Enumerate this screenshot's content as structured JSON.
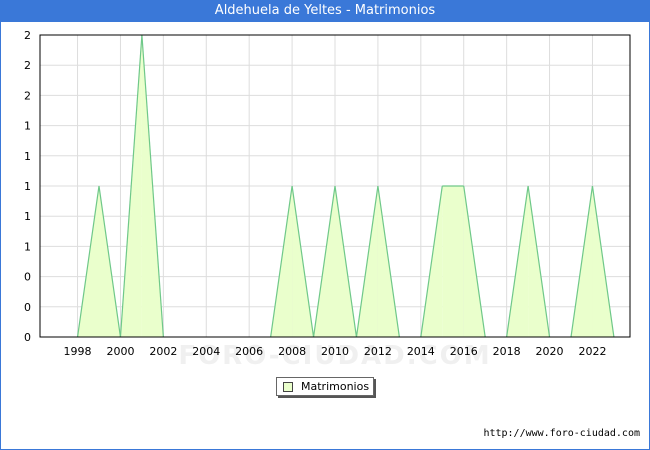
{
  "title": "Aldehuela de Yeltes - Matrimonios",
  "legend_label": "Matrimonios",
  "source": "http://www.foro-ciudad.com",
  "watermark": "FORO-CIUDAD.COM",
  "colors": {
    "titlebar": "#3a78d8",
    "fill": "#eaffcc",
    "line": "#6fc889",
    "grid": "#dddddd"
  },
  "chart_data": {
    "type": "area",
    "title": "Aldehuela de Yeltes - Matrimonios",
    "xlabel": "",
    "ylabel": "",
    "x": [
      1998,
      1999,
      2000,
      2001,
      2002,
      2003,
      2004,
      2005,
      2006,
      2007,
      2008,
      2009,
      2010,
      2011,
      2012,
      2013,
      2014,
      2015,
      2016,
      2017,
      2018,
      2019,
      2020,
      2021,
      2022,
      2023
    ],
    "series": [
      {
        "name": "Matrimonios",
        "values": [
          0,
          1,
          0,
          2,
          0,
          0,
          0,
          0,
          0,
          0,
          1,
          0,
          1,
          0,
          1,
          0,
          0,
          1,
          1,
          0,
          0,
          1,
          0,
          0,
          1,
          0
        ]
      }
    ],
    "xlim": [
      1996.25,
      2023.75
    ],
    "ylim": [
      0,
      2
    ],
    "x_tick_labels": [
      "1998",
      "2000",
      "2002",
      "2004",
      "2006",
      "2008",
      "2010",
      "2012",
      "2014",
      "2016",
      "2018",
      "2020",
      "2022"
    ],
    "y_tick_labels": [
      "0",
      "0",
      "0",
      "1",
      "1",
      "1",
      "1",
      "1",
      "2",
      "2",
      "2"
    ],
    "grid": true,
    "legend": "bottom-center"
  }
}
